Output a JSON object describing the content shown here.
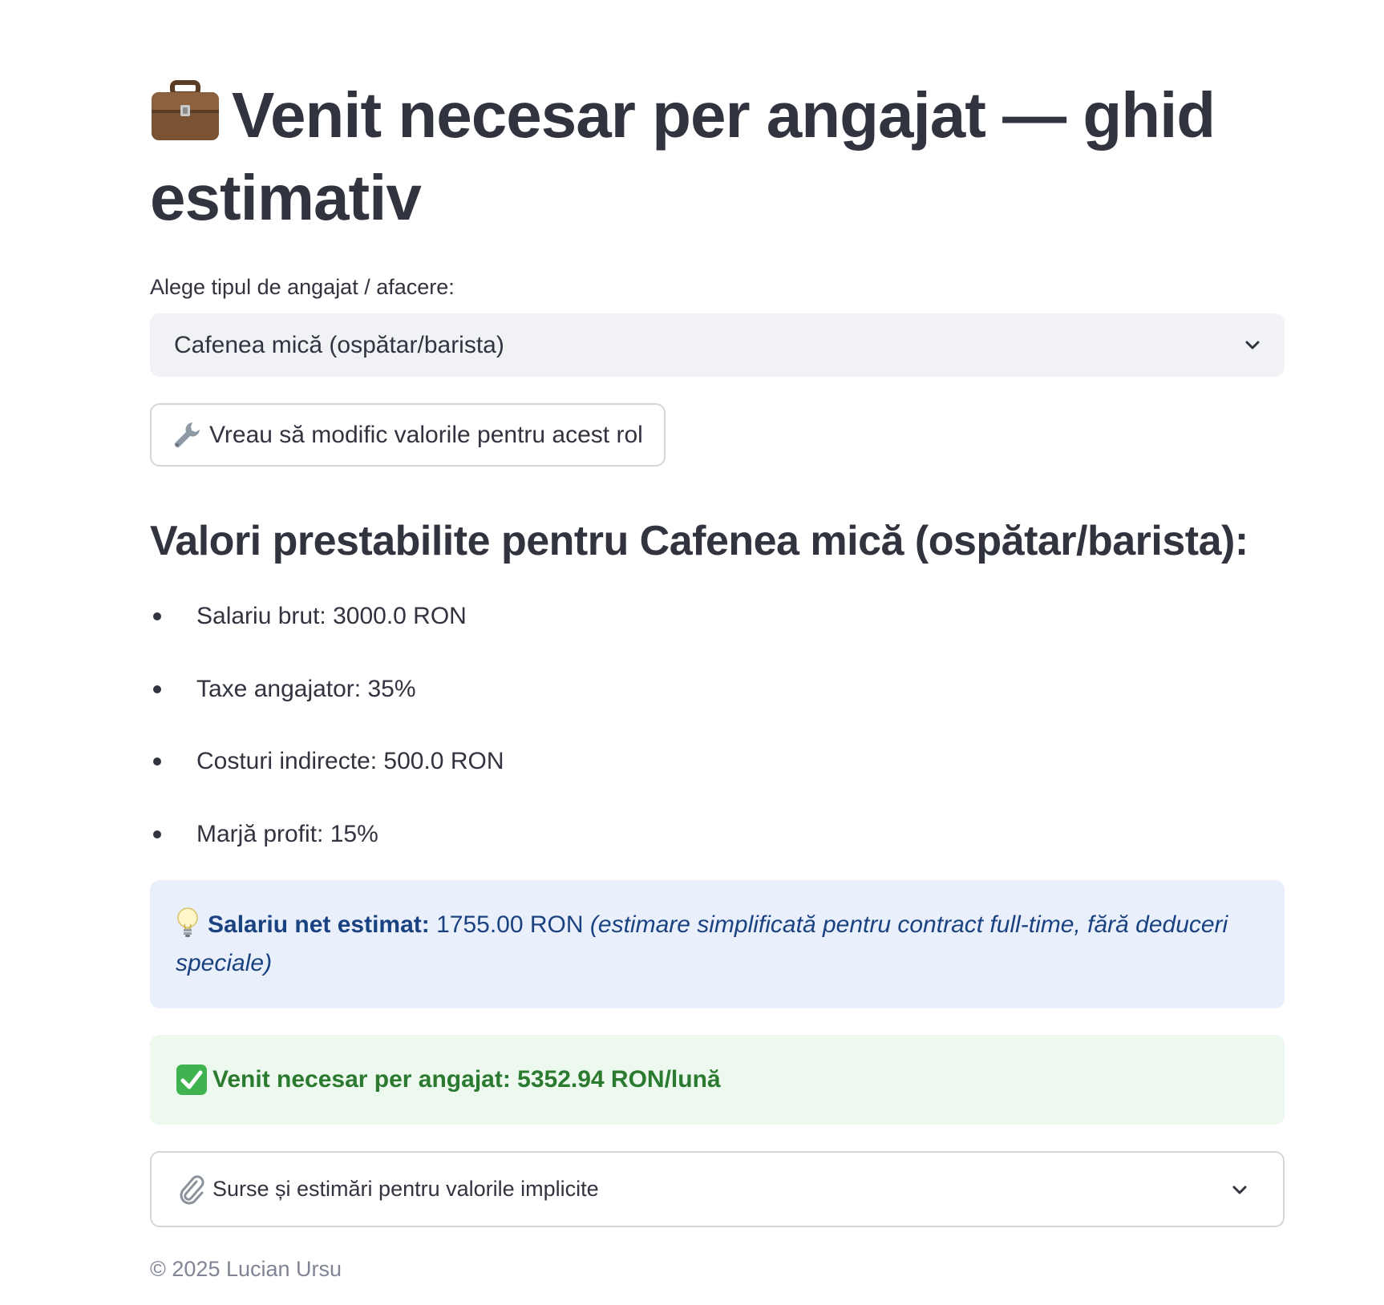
{
  "header": {
    "title": "Venit necesar per angajat — ghid estimativ",
    "title_icon": "briefcase-icon"
  },
  "selector": {
    "label": "Alege tipul de angajat / afacere:",
    "selected_value": "Cafenea mică (ospătar/barista)",
    "icon": "chevron-down-icon"
  },
  "edit_button": {
    "icon": "wrench-icon",
    "label": "Vreau să modific valorile pentru acest rol"
  },
  "defaults": {
    "heading": "Valori prestabilite pentru Cafenea mică (ospătar/barista):",
    "items": [
      "Salariu brut: 3000.0 RON",
      "Taxe angajator: 35%",
      "Costuri indirecte: 500.0 RON",
      "Marjă profit: 15%"
    ]
  },
  "info_box": {
    "icon": "lightbulb-icon",
    "label": "Salariu net estimat:",
    "value": "1755.00 RON",
    "note": "(estimare simplificată pentru contract full-time, fără deduceri speciale)",
    "bg_color": "#e9f0fb",
    "text_color": "#1a4180"
  },
  "result_box": {
    "icon": "check-mark-icon",
    "text": "Venit necesar per angajat: 5352.94 RON/lună",
    "bg_color": "#edf8ee",
    "text_color": "#2a7a2f"
  },
  "sources_expander": {
    "icon": "paperclip-icon",
    "label": "Surse și estimări pentru valorile implicite",
    "expanded": false
  },
  "footer": {
    "text": "© 2025 Lucian Ursu"
  }
}
